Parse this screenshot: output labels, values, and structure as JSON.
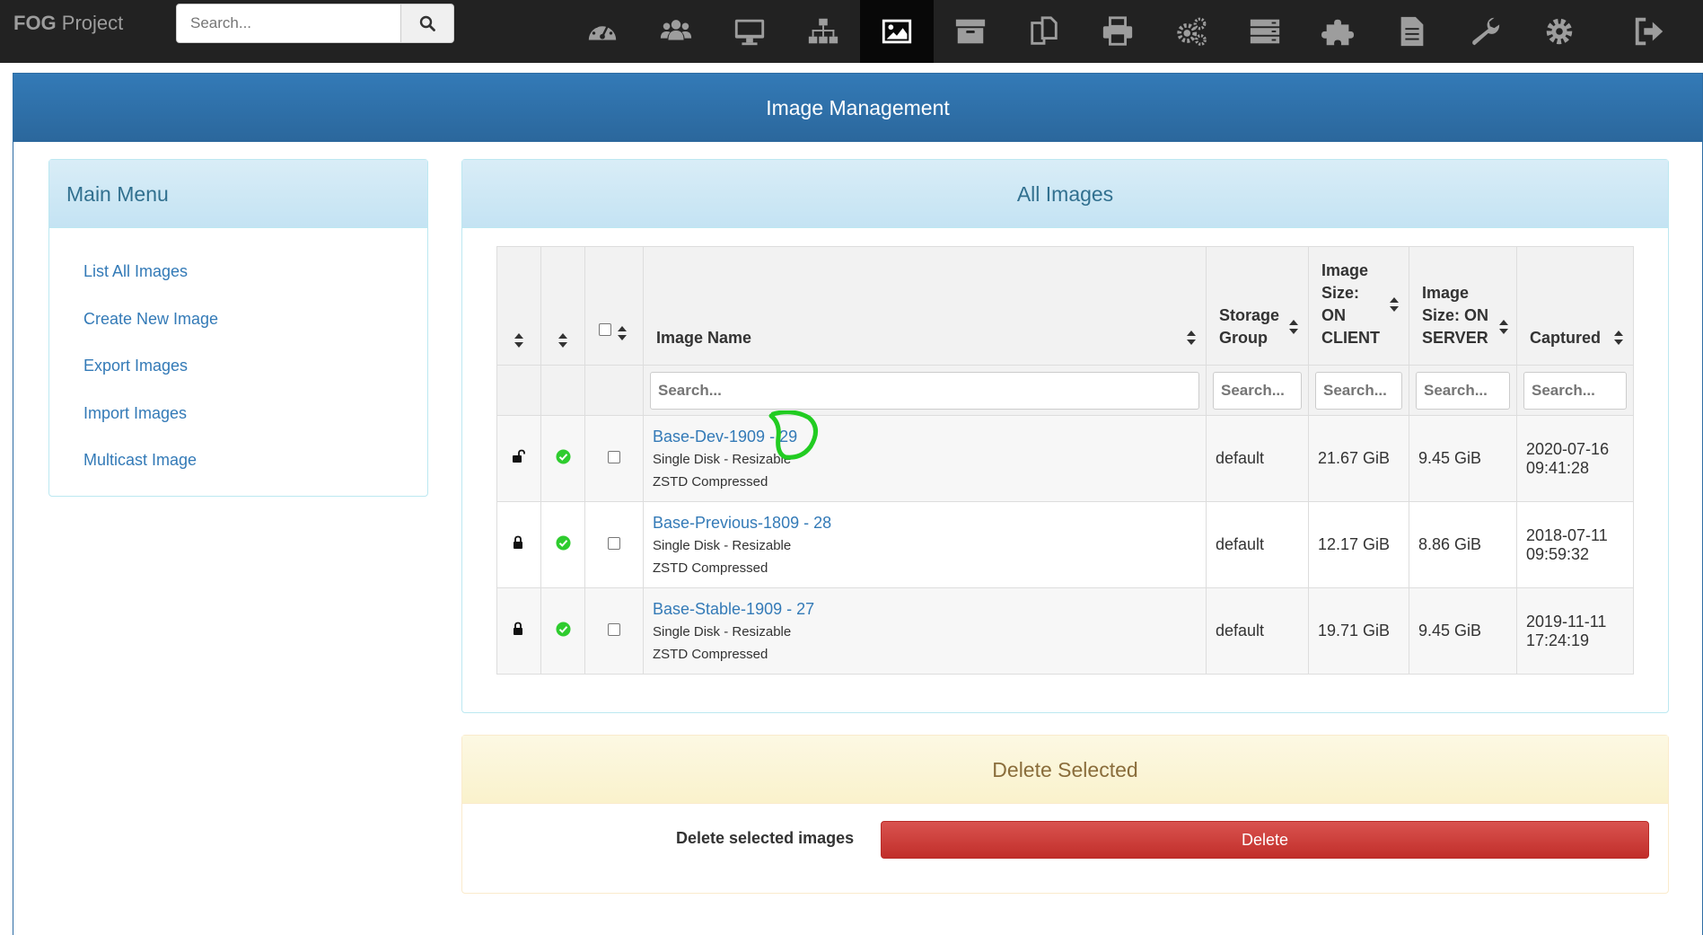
{
  "navbar": {
    "brand_bold": "FOG",
    "brand_rest": " Project",
    "search_placeholder": "Search...",
    "icons": [
      "dashboard-icon",
      "users-icon",
      "desktop-icon",
      "sitemap-icon",
      "image-icon",
      "archive-icon",
      "copy-icon",
      "print-icon",
      "cogs-icon",
      "server-icon",
      "puzzle-icon",
      "file-icon",
      "wrench-icon",
      "settings-icon",
      "logout-icon"
    ],
    "active_icon": "image-icon"
  },
  "page": {
    "title": "Image Management"
  },
  "side_menu": {
    "title": "Main Menu",
    "items": [
      "List All Images",
      "Create New Image",
      "Export Images",
      "Import Images",
      "Multicast Image"
    ]
  },
  "all_images": {
    "title": "All Images",
    "columns": {
      "image_name": "Image Name",
      "storage_group_1": "Storage",
      "storage_group_2": "Group",
      "client_1": "Image",
      "client_2": "Size:",
      "client_3": "ON",
      "client_4": "CLIENT",
      "server_1": "Image",
      "server_2": "Size: ON",
      "server_3": "SERVER",
      "captured": "Captured"
    },
    "filter_placeholder": "Search...",
    "rows": [
      {
        "name": "Base-Dev-1909 - 29",
        "disk": "Single Disk - Resizable",
        "compression": "ZSTD Compressed",
        "storage_group": "default",
        "size_client": "21.67 GiB",
        "size_server": "9.45 GiB",
        "captured_date": "2020-07-16",
        "captured_time": "09:41:28",
        "locked": false
      },
      {
        "name": "Base-Previous-1809 - 28",
        "disk": "Single Disk - Resizable",
        "compression": "ZSTD Compressed",
        "storage_group": "default",
        "size_client": "12.17 GiB",
        "size_server": "8.86 GiB",
        "captured_date": "2018-07-11",
        "captured_time": "09:59:32",
        "locked": true
      },
      {
        "name": "Base-Stable-1909 - 27",
        "disk": "Single Disk - Resizable",
        "compression": "ZSTD Compressed",
        "storage_group": "default",
        "size_client": "19.71 GiB",
        "size_server": "9.45 GiB",
        "captured_date": "2019-11-11",
        "captured_time": "17:24:19",
        "locked": true
      }
    ]
  },
  "delete_panel": {
    "title": "Delete Selected",
    "label": "Delete selected images",
    "button": "Delete"
  },
  "colors": {
    "navbar": "#222222",
    "primary": "#337ab7",
    "success": "#2ecc2e",
    "danger": "#d9534f",
    "annotation": "#22cc22"
  }
}
